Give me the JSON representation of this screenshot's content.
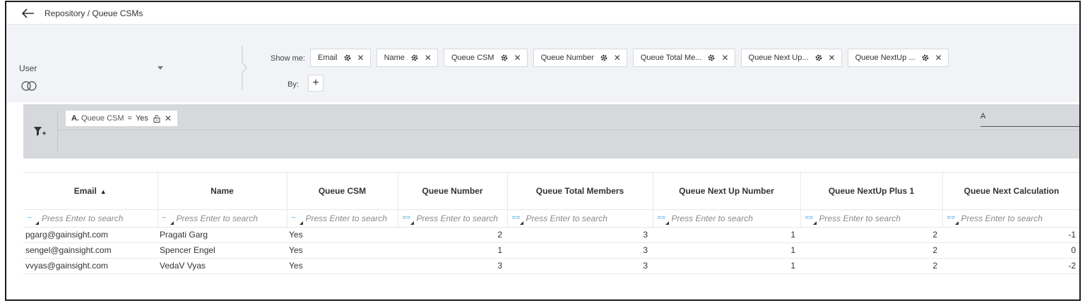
{
  "header": {
    "breadcrumb": "Repository / Queue CSMs"
  },
  "config": {
    "object_value": "User",
    "show_me_label": "Show me:",
    "by_label": "By:",
    "add_label": "+",
    "show_fields": [
      {
        "label": "Email"
      },
      {
        "label": "Name"
      },
      {
        "label": "Queue CSM"
      },
      {
        "label": "Queue Number"
      },
      {
        "label": "Queue Total Me..."
      },
      {
        "label": "Queue Next Up..."
      },
      {
        "label": "Queue NextUp ..."
      }
    ]
  },
  "filter": {
    "chip": {
      "letter": "A.",
      "field": "Queue CSM",
      "operator": "=",
      "value": "Yes"
    },
    "advanced_logic": "A"
  },
  "grid": {
    "search_placeholder": "Press Enter to search",
    "columns": [
      {
        "label": "Email",
        "sort": "▲",
        "op": "~"
      },
      {
        "label": "Name",
        "op": "~"
      },
      {
        "label": "Queue CSM",
        "op": "~"
      },
      {
        "label": "Queue Number",
        "op": "=="
      },
      {
        "label": "Queue Total Members",
        "op": "=="
      },
      {
        "label": "Queue Next Up Number",
        "op": "=="
      },
      {
        "label": "Queue NextUp Plus 1",
        "op": "=="
      },
      {
        "label": "Queue Next Calculation",
        "op": "=="
      }
    ],
    "rows": [
      [
        "pgarg@gainsight.com",
        "Pragati Garg",
        "Yes",
        "2",
        "3",
        "1",
        "2",
        "-1"
      ],
      [
        "sengel@gainsight.com",
        "Spencer Engel",
        "Yes",
        "1",
        "3",
        "1",
        "2",
        "0"
      ],
      [
        "vvyas@gainsight.com",
        "VedaV Vyas",
        "Yes",
        "3",
        "3",
        "1",
        "2",
        "-2"
      ]
    ]
  },
  "colors": {
    "accent": "#3aa0d8",
    "filter_bg": "#d6d8db",
    "config_bg": "#f1f3f6"
  }
}
